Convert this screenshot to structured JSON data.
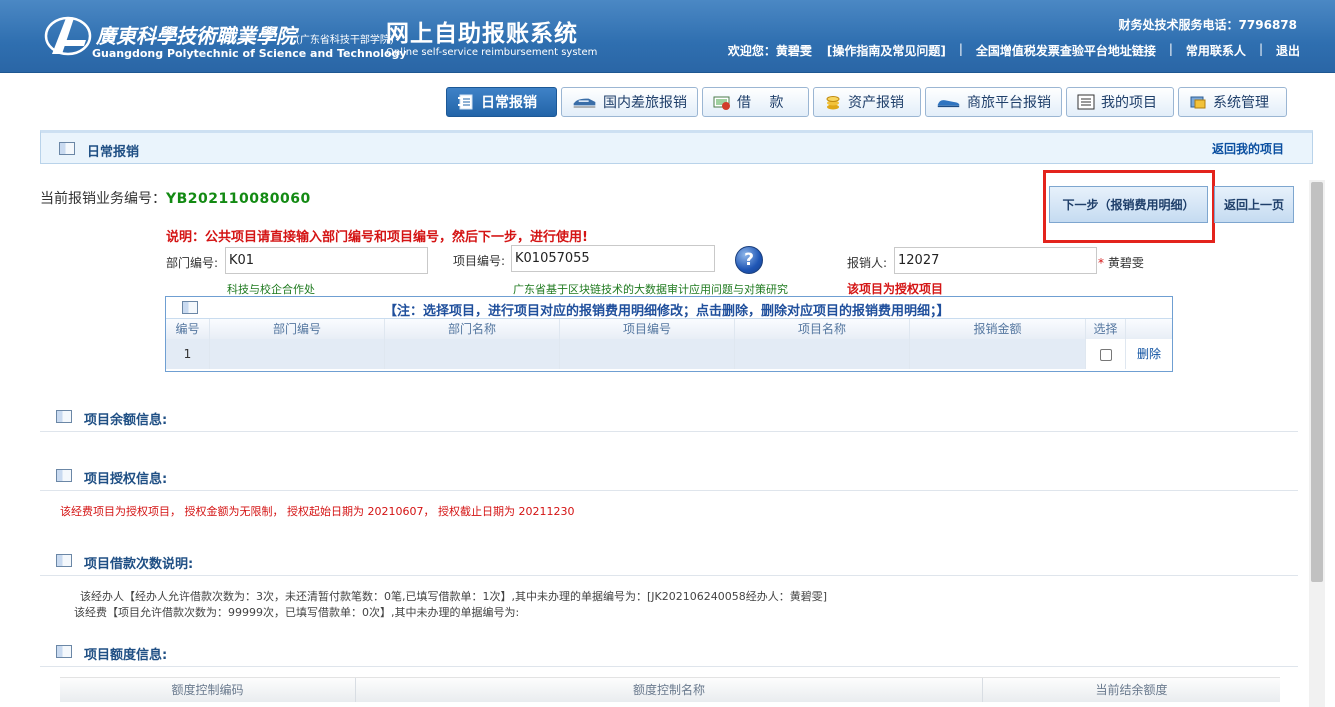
{
  "header": {
    "school_cn": "廣東科學技術職業學院",
    "school_cn_sub": "(广东省科技干部学院)",
    "school_en": "Guangdong Polytechnic of Science and Technology",
    "system_title": "网上自助报账系统",
    "system_subtitle": "Online self-service reimbursement system",
    "hotline": "财务处技术服务电话：7796878",
    "welcome": "欢迎您：黄碧雯",
    "guide_link": "[操作指南及常见问题]",
    "invoice_link": "全国增值税发票查验平台地址链接",
    "contacts_link": "常用联系人",
    "logout_link": "退出",
    "separator": "|"
  },
  "menu": [
    {
      "label": "日常报销",
      "icon": "notebook-icon"
    },
    {
      "label": "国内差旅报销",
      "icon": "train-icon"
    },
    {
      "label": "借　 款",
      "icon": "money-icon"
    },
    {
      "label": "资产报销",
      "icon": "coins-icon"
    },
    {
      "label": "商旅平台报销",
      "icon": "shoe-icon"
    },
    {
      "label": "我的项目",
      "icon": "list-icon"
    },
    {
      "label": "系统管理",
      "icon": "admin-icon"
    }
  ],
  "section": {
    "title": "日常报销",
    "back_to_projects": "返回我的项目"
  },
  "business": {
    "label": "当前报销业务编号：",
    "number": "YB202110080060",
    "next_button": "下一步（报销费用明细）",
    "back_button": "返回上一页"
  },
  "form": {
    "note": "说明：公共项目请直接输入部门编号和项目编号，然后下一步，进行使用!",
    "dept_label": "部门编号:",
    "dept_value": "K01",
    "dept_name": "科技与校企合作处",
    "project_label": "项目编号:",
    "project_value": "K01057055",
    "project_name": "广东省基于区块链技术的大数据审计应用问题与对策研究",
    "applicant_label": "报销人:",
    "applicant_value": "12027",
    "applicant_required": "*",
    "applicant_name": "黄碧雯",
    "authorized_note": "该项目为授权项目",
    "help_glyph": "?"
  },
  "items_table": {
    "caption": "【注：选择项目，进行项目对应的报销费用明细修改；点击删除，删除对应项目的报销费用明细；】",
    "headers": [
      "编号",
      "部门编号",
      "部门名称",
      "项目编号",
      "项目名称",
      "报销金额",
      "选择",
      ""
    ],
    "rows": [
      {
        "no": "1",
        "dept_no": "",
        "dept_name": "",
        "project_no": "",
        "project_name": "",
        "amount": "",
        "delete": "删除"
      }
    ]
  },
  "balance": {
    "title": "项目余额信息:"
  },
  "authorization": {
    "title": "项目授权信息:",
    "text": "该经费项目为授权项目， 授权金额为无限制， 授权起始日期为 20210607， 授权截止日期为 20211230"
  },
  "loan": {
    "title": "项目借款次数说明:",
    "line1": "该经办人【经办人允许借款次数为：3次，未还清暂付款笔数：0笔,已填写借款单：1次】,其中未办理的单据编号为：[JK202106240058经办人：黄碧雯]",
    "line2": "该经费【项目允许借款次数为：99999次，已填写借款单：0次】,其中未办理的单据编号为:"
  },
  "quota": {
    "title": "项目额度信息:",
    "headers": [
      "额度控制编码",
      "额度控制名称",
      "当前结余额度"
    ]
  },
  "colors": {
    "header_blue": "#2f6fb0",
    "highlight_red": "#e3231c",
    "number_green": "#138a13",
    "note_red": "#d41414"
  }
}
